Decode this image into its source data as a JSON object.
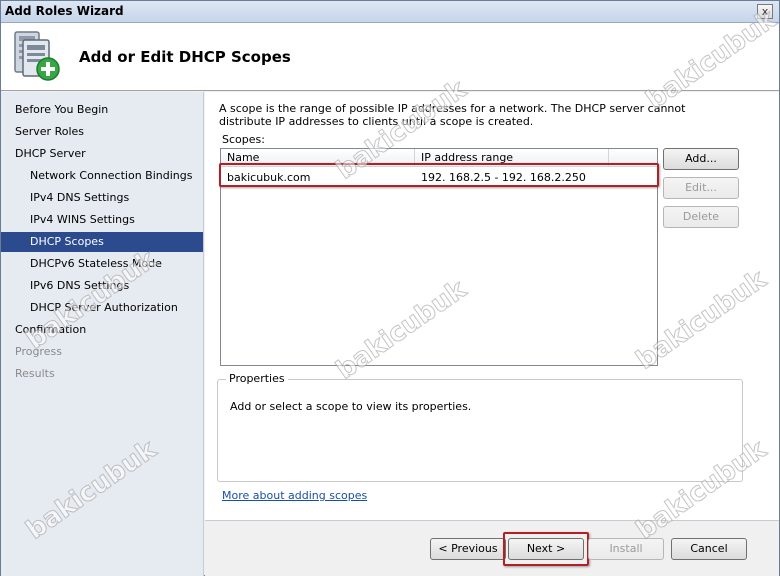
{
  "window": {
    "title": "Add Roles Wizard",
    "close_glyph": "x",
    "icon": "server-add-icon"
  },
  "header": {
    "title": "Add or Edit DHCP Scopes"
  },
  "sidebar": {
    "items": [
      {
        "label": "Before You Begin",
        "level": "top",
        "state": "normal"
      },
      {
        "label": "Server Roles",
        "level": "top",
        "state": "normal"
      },
      {
        "label": "DHCP Server",
        "level": "top",
        "state": "normal"
      },
      {
        "label": "Network Connection Bindings",
        "level": "sub",
        "state": "normal"
      },
      {
        "label": "IPv4 DNS Settings",
        "level": "sub",
        "state": "normal"
      },
      {
        "label": "IPv4 WINS Settings",
        "level": "sub",
        "state": "normal"
      },
      {
        "label": "DHCP Scopes",
        "level": "sub",
        "state": "active"
      },
      {
        "label": "DHCPv6 Stateless Mode",
        "level": "sub",
        "state": "normal"
      },
      {
        "label": "IPv6 DNS Settings",
        "level": "sub",
        "state": "normal"
      },
      {
        "label": "DHCP Server Authorization",
        "level": "sub",
        "state": "normal"
      },
      {
        "label": "Confirmation",
        "level": "top",
        "state": "normal"
      },
      {
        "label": "Progress",
        "level": "top",
        "state": "disabled"
      },
      {
        "label": "Results",
        "level": "top",
        "state": "disabled"
      }
    ]
  },
  "main": {
    "description": "A scope is the range of possible IP addresses for a network. The DHCP server cannot distribute IP addresses to clients until a scope is created.",
    "scopes_label": "Scopes:",
    "columns": [
      "Name",
      "IP address range"
    ],
    "rows": [
      {
        "name": "bakicubuk.com",
        "range": "192. 168.2.5 - 192. 168.2.250"
      }
    ],
    "buttons": {
      "add": "Add...",
      "edit": "Edit...",
      "delete": "Delete"
    },
    "properties": {
      "legend": "Properties",
      "text": "Add or select a scope to view its properties."
    },
    "more_link": "More about adding scopes"
  },
  "footer": {
    "previous": "< Previous",
    "next": "Next >",
    "install": "Install",
    "cancel": "Cancel"
  },
  "watermark": "bakicubuk",
  "colors": {
    "active_nav": "#2c4b8f",
    "highlight_box": "#b31f24",
    "link": "#1a4fa8"
  }
}
